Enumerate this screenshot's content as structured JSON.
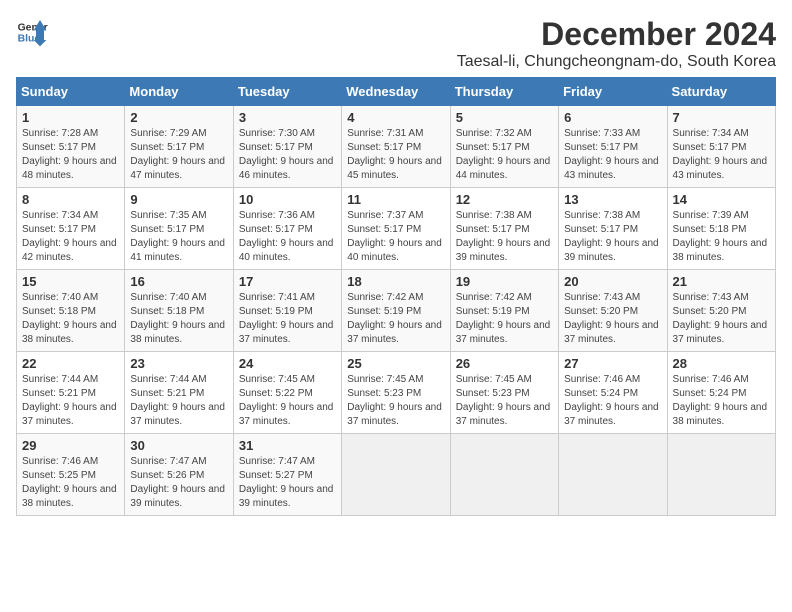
{
  "header": {
    "logo_line1": "General",
    "logo_line2": "Blue",
    "title": "December 2024",
    "subtitle": "Taesal-li, Chungcheongnam-do, South Korea"
  },
  "calendar": {
    "days_of_week": [
      "Sunday",
      "Monday",
      "Tuesday",
      "Wednesday",
      "Thursday",
      "Friday",
      "Saturday"
    ],
    "weeks": [
      [
        {
          "day": "",
          "empty": true
        },
        {
          "day": "",
          "empty": true
        },
        {
          "day": "",
          "empty": true
        },
        {
          "day": "",
          "empty": true
        },
        {
          "day": "",
          "empty": true
        },
        {
          "day": "",
          "empty": true
        },
        {
          "day": "",
          "empty": true
        }
      ],
      [
        {
          "day": "1",
          "rise": "Sunrise: 7:28 AM",
          "set": "Sunset: 5:17 PM",
          "light": "Daylight: 9 hours and 48 minutes."
        },
        {
          "day": "2",
          "rise": "Sunrise: 7:29 AM",
          "set": "Sunset: 5:17 PM",
          "light": "Daylight: 9 hours and 47 minutes."
        },
        {
          "day": "3",
          "rise": "Sunrise: 7:30 AM",
          "set": "Sunset: 5:17 PM",
          "light": "Daylight: 9 hours and 46 minutes."
        },
        {
          "day": "4",
          "rise": "Sunrise: 7:31 AM",
          "set": "Sunset: 5:17 PM",
          "light": "Daylight: 9 hours and 45 minutes."
        },
        {
          "day": "5",
          "rise": "Sunrise: 7:32 AM",
          "set": "Sunset: 5:17 PM",
          "light": "Daylight: 9 hours and 44 minutes."
        },
        {
          "day": "6",
          "rise": "Sunrise: 7:33 AM",
          "set": "Sunset: 5:17 PM",
          "light": "Daylight: 9 hours and 43 minutes."
        },
        {
          "day": "7",
          "rise": "Sunrise: 7:34 AM",
          "set": "Sunset: 5:17 PM",
          "light": "Daylight: 9 hours and 43 minutes."
        }
      ],
      [
        {
          "day": "8",
          "rise": "Sunrise: 7:34 AM",
          "set": "Sunset: 5:17 PM",
          "light": "Daylight: 9 hours and 42 minutes."
        },
        {
          "day": "9",
          "rise": "Sunrise: 7:35 AM",
          "set": "Sunset: 5:17 PM",
          "light": "Daylight: 9 hours and 41 minutes."
        },
        {
          "day": "10",
          "rise": "Sunrise: 7:36 AM",
          "set": "Sunset: 5:17 PM",
          "light": "Daylight: 9 hours and 40 minutes."
        },
        {
          "day": "11",
          "rise": "Sunrise: 7:37 AM",
          "set": "Sunset: 5:17 PM",
          "light": "Daylight: 9 hours and 40 minutes."
        },
        {
          "day": "12",
          "rise": "Sunrise: 7:38 AM",
          "set": "Sunset: 5:17 PM",
          "light": "Daylight: 9 hours and 39 minutes."
        },
        {
          "day": "13",
          "rise": "Sunrise: 7:38 AM",
          "set": "Sunset: 5:17 PM",
          "light": "Daylight: 9 hours and 39 minutes."
        },
        {
          "day": "14",
          "rise": "Sunrise: 7:39 AM",
          "set": "Sunset: 5:18 PM",
          "light": "Daylight: 9 hours and 38 minutes."
        }
      ],
      [
        {
          "day": "15",
          "rise": "Sunrise: 7:40 AM",
          "set": "Sunset: 5:18 PM",
          "light": "Daylight: 9 hours and 38 minutes."
        },
        {
          "day": "16",
          "rise": "Sunrise: 7:40 AM",
          "set": "Sunset: 5:18 PM",
          "light": "Daylight: 9 hours and 38 minutes."
        },
        {
          "day": "17",
          "rise": "Sunrise: 7:41 AM",
          "set": "Sunset: 5:19 PM",
          "light": "Daylight: 9 hours and 37 minutes."
        },
        {
          "day": "18",
          "rise": "Sunrise: 7:42 AM",
          "set": "Sunset: 5:19 PM",
          "light": "Daylight: 9 hours and 37 minutes."
        },
        {
          "day": "19",
          "rise": "Sunrise: 7:42 AM",
          "set": "Sunset: 5:19 PM",
          "light": "Daylight: 9 hours and 37 minutes."
        },
        {
          "day": "20",
          "rise": "Sunrise: 7:43 AM",
          "set": "Sunset: 5:20 PM",
          "light": "Daylight: 9 hours and 37 minutes."
        },
        {
          "day": "21",
          "rise": "Sunrise: 7:43 AM",
          "set": "Sunset: 5:20 PM",
          "light": "Daylight: 9 hours and 37 minutes."
        }
      ],
      [
        {
          "day": "22",
          "rise": "Sunrise: 7:44 AM",
          "set": "Sunset: 5:21 PM",
          "light": "Daylight: 9 hours and 37 minutes."
        },
        {
          "day": "23",
          "rise": "Sunrise: 7:44 AM",
          "set": "Sunset: 5:21 PM",
          "light": "Daylight: 9 hours and 37 minutes."
        },
        {
          "day": "24",
          "rise": "Sunrise: 7:45 AM",
          "set": "Sunset: 5:22 PM",
          "light": "Daylight: 9 hours and 37 minutes."
        },
        {
          "day": "25",
          "rise": "Sunrise: 7:45 AM",
          "set": "Sunset: 5:23 PM",
          "light": "Daylight: 9 hours and 37 minutes."
        },
        {
          "day": "26",
          "rise": "Sunrise: 7:45 AM",
          "set": "Sunset: 5:23 PM",
          "light": "Daylight: 9 hours and 37 minutes."
        },
        {
          "day": "27",
          "rise": "Sunrise: 7:46 AM",
          "set": "Sunset: 5:24 PM",
          "light": "Daylight: 9 hours and 37 minutes."
        },
        {
          "day": "28",
          "rise": "Sunrise: 7:46 AM",
          "set": "Sunset: 5:24 PM",
          "light": "Daylight: 9 hours and 38 minutes."
        }
      ],
      [
        {
          "day": "29",
          "rise": "Sunrise: 7:46 AM",
          "set": "Sunset: 5:25 PM",
          "light": "Daylight: 9 hours and 38 minutes."
        },
        {
          "day": "30",
          "rise": "Sunrise: 7:47 AM",
          "set": "Sunset: 5:26 PM",
          "light": "Daylight: 9 hours and 39 minutes."
        },
        {
          "day": "31",
          "rise": "Sunrise: 7:47 AM",
          "set": "Sunset: 5:27 PM",
          "light": "Daylight: 9 hours and 39 minutes."
        },
        {
          "day": "",
          "empty": true
        },
        {
          "day": "",
          "empty": true
        },
        {
          "day": "",
          "empty": true
        },
        {
          "day": "",
          "empty": true
        }
      ]
    ]
  }
}
